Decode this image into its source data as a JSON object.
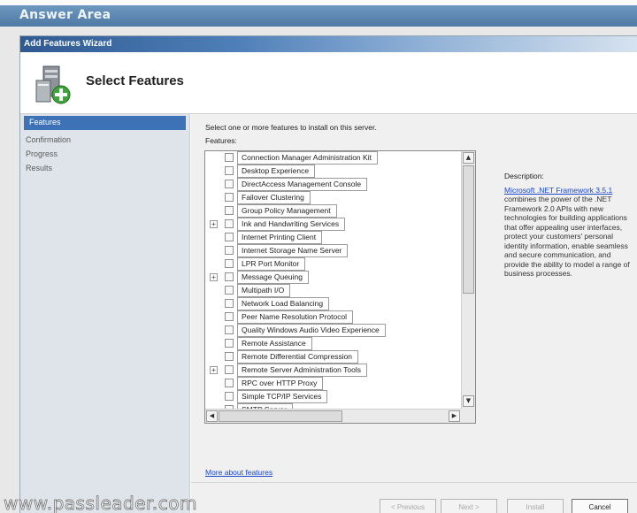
{
  "answer_area": {
    "title": "Answer Area"
  },
  "window": {
    "title": "Add Features Wizard"
  },
  "header": {
    "title": "Select Features"
  },
  "sidebar": {
    "steps": [
      {
        "label": "Features",
        "active": true
      },
      {
        "label": "Confirmation",
        "active": false
      },
      {
        "label": "Progress",
        "active": false
      },
      {
        "label": "Results",
        "active": false
      }
    ]
  },
  "main": {
    "intro": "Select one or more features to install on this server.",
    "features_label": "Features:",
    "features": [
      {
        "label": "Connection Manager Administration Kit",
        "expandable": false,
        "checked": false
      },
      {
        "label": "Desktop Experience",
        "expandable": false,
        "checked": false
      },
      {
        "label": "DirectAccess Management Console",
        "expandable": false,
        "checked": false
      },
      {
        "label": "Failover Clustering",
        "expandable": false,
        "checked": false
      },
      {
        "label": "Group Policy Management",
        "expandable": false,
        "checked": false
      },
      {
        "label": "Ink and Handwriting Services",
        "expandable": true,
        "checked": false
      },
      {
        "label": "Internet Printing Client",
        "expandable": false,
        "checked": false
      },
      {
        "label": "Internet Storage Name Server",
        "expandable": false,
        "checked": false
      },
      {
        "label": "LPR Port Monitor",
        "expandable": false,
        "checked": false
      },
      {
        "label": "Message Queuing",
        "expandable": true,
        "checked": false
      },
      {
        "label": "Multipath I/O",
        "expandable": false,
        "checked": false
      },
      {
        "label": "Network Load Balancing",
        "expandable": false,
        "checked": false
      },
      {
        "label": "Peer Name Resolution Protocol",
        "expandable": false,
        "checked": false
      },
      {
        "label": "Quality Windows Audio Video Experience",
        "expandable": false,
        "checked": false
      },
      {
        "label": "Remote Assistance",
        "expandable": false,
        "checked": false
      },
      {
        "label": "Remote Differential Compression",
        "expandable": false,
        "checked": false
      },
      {
        "label": "Remote Server Administration Tools",
        "expandable": true,
        "checked": false
      },
      {
        "label": "RPC over HTTP Proxy",
        "expandable": false,
        "checked": false
      },
      {
        "label": "Simple TCP/IP Services",
        "expandable": false,
        "checked": false
      },
      {
        "label": "SMTP Server",
        "expandable": false,
        "checked": false
      }
    ],
    "description_label": "Description:",
    "description_link": "Microsoft .NET Framework 3.5.1",
    "description_text": "combines the power of the .NET Framework 2.0 APIs with new technologies for building applications that offer appealing user interfaces, protect your customers' personal identity information, enable seamless and secure communication, and provide the ability to model a range of business processes.",
    "more_link": "More about features"
  },
  "buttons": {
    "previous": "< Previous",
    "next": "Next >",
    "install": "Install",
    "cancel": "Cancel"
  },
  "watermark": "www.passleader.com"
}
